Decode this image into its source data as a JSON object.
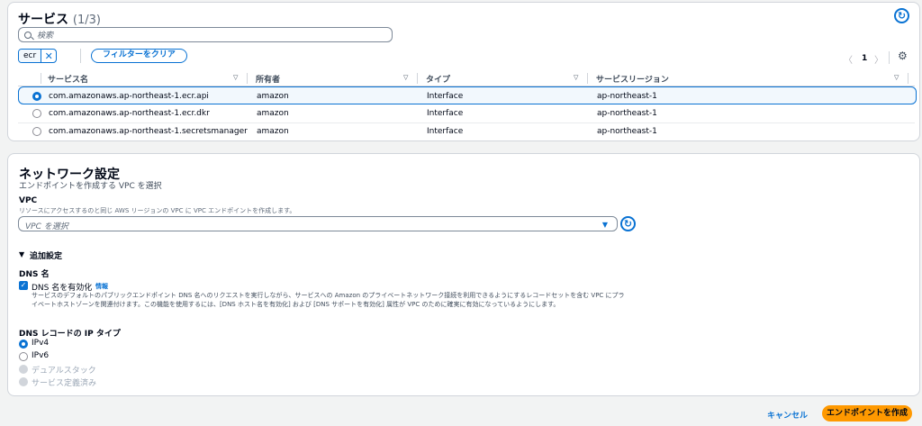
{
  "services": {
    "title": "サービス",
    "count": "(1/3)",
    "search_placeholder": "検索",
    "filter_token": "ecr",
    "clear_filters_label": "フィルターをクリア",
    "pagination": {
      "prev": "〈",
      "page": "1",
      "next": "〉"
    },
    "columns": [
      "サービス名",
      "所有者",
      "タイプ",
      "サービスリージョン"
    ],
    "rows": [
      {
        "name": "com.amazonaws.ap-northeast-1.ecr.api",
        "owner": "amazon",
        "type": "Interface",
        "region": "ap-northeast-1",
        "selected": true
      },
      {
        "name": "com.amazonaws.ap-northeast-1.ecr.dkr",
        "owner": "amazon",
        "type": "Interface",
        "region": "ap-northeast-1",
        "selected": false
      },
      {
        "name": "com.amazonaws.ap-northeast-1.secretsmanager",
        "owner": "amazon",
        "type": "Interface",
        "region": "ap-northeast-1",
        "selected": false
      }
    ]
  },
  "network": {
    "title": "ネットワーク設定",
    "description": "エンドポイントを作成する VPC を選択",
    "vpc_label": "VPC",
    "vpc_description": "リソースにアクセスするのと同じ AWS リージョンの VPC に VPC エンドポイントを作成します。",
    "vpc_placeholder": "VPC を選択",
    "additional_settings": "追加設定",
    "dns_name_label": "DNS 名",
    "dns_enable_label": "DNS 名を有効化",
    "info_link": "情報",
    "dns_description": "サービスのデフォルトのパブリックエンドポイント DNS 名へのリクエストを実行しながら、サービスへの Amazon のプライベートネットワーク接続を利用できるようにするレコードセットを含む VPC にプライベートホストゾーンを関連付けます。この機能を使用するには、[DNS ホスト名を有効化] および [DNS サポートを有効化] 属性が VPC のために確実に有効になっているようにします。",
    "ip_type_label": "DNS レコードの IP タイプ",
    "ip_options": [
      {
        "label": "IPv4",
        "state": "selected"
      },
      {
        "label": "IPv6",
        "state": "enabled"
      },
      {
        "label": "デュアルスタック",
        "state": "disabled"
      },
      {
        "label": "サービス定義済み",
        "state": "disabled"
      }
    ]
  },
  "footer": {
    "cancel_label": "キャンセル",
    "create_label": "エンドポイントを作成"
  },
  "colors": {
    "accent": "#0972d3",
    "primary_button": "#ff9900"
  }
}
